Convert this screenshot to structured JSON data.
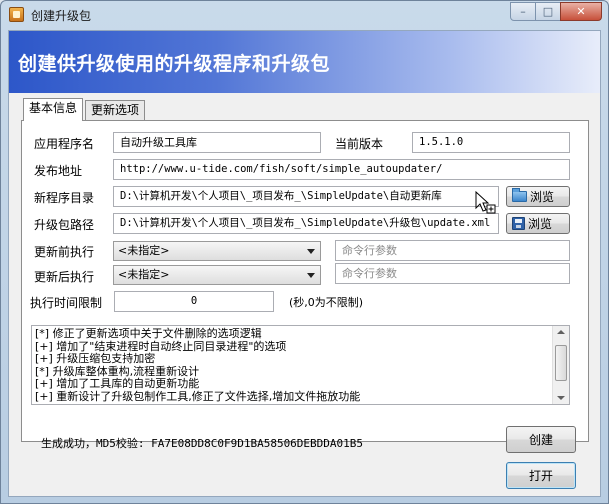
{
  "window": {
    "title": "创建升级包",
    "minimize": "–",
    "maximize": "□",
    "close": "✕"
  },
  "banner": {
    "title": "创建供升级使用的升级程序和升级包"
  },
  "tabs": [
    {
      "label": "基本信息",
      "active": true
    },
    {
      "label": "更新选项",
      "active": false
    }
  ],
  "form": {
    "app_name_label": "应用程序名",
    "app_name_value": "自动升级工具库",
    "version_label": "当前版本",
    "version_value": "1.5.1.0",
    "publish_url_label": "发布地址",
    "publish_url_value": "http://www.u-tide.com/fish/soft/simple_autoupdater/",
    "new_dir_label": "新程序目录",
    "new_dir_value": "D:\\计算机开发\\个人项目\\_项目发布_\\SimpleUpdate\\自动更新库",
    "package_path_label": "升级包路径",
    "package_path_value": "D:\\计算机开发\\个人项目\\_项目发布_\\SimpleUpdate\\升级包\\update.xml",
    "browse_label": "浏览",
    "pre_exec_label": "更新前执行",
    "pre_exec_value": "<未指定>",
    "pre_args_placeholder": "命令行参数",
    "post_exec_label": "更新后执行",
    "post_exec_value": "<未指定>",
    "post_args_placeholder": "命令行参数",
    "time_limit_label": "执行时间限制",
    "time_limit_value": "0",
    "time_limit_hint": "(秒,0为不限制)"
  },
  "changelog": [
    "[*] 修正了更新选项中关于文件删除的选项逻辑",
    "[+] 增加了\"结束进程时自动终止同目录进程\"的选项",
    "[+] 升级压缩包支持加密",
    "[*] 升级库整体重构,流程重新设计",
    "[+] 增加了工具库的自动更新功能",
    "[+] 重新设计了升级包制作工具,修正了文件选择,增加文件拖放功能"
  ],
  "status": "生成成功，MD5校验: FA7E08DD8C0F9D1BA58506DEBDDA01B5",
  "actions": {
    "create_label": "创建",
    "open_label": "打开"
  }
}
